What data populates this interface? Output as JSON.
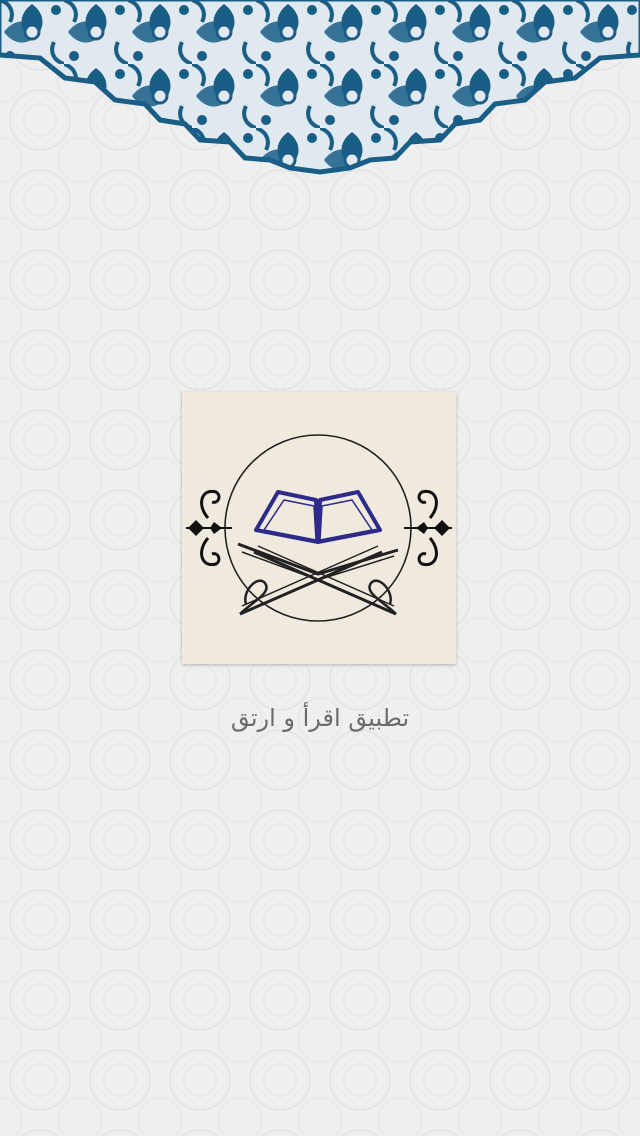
{
  "splash": {
    "app_name": "تطبيق اقرأ و ارتق",
    "logo_icon": "quran-on-stand-icon",
    "ornament": "islamic-arabesque-ornament"
  },
  "colors": {
    "background": "#efefef",
    "pattern_line": "#e2e2e2",
    "ornament_dark": "#1a5e86",
    "ornament_light": "#dfe9ef",
    "logo_background": "#f0e9dd",
    "book_outline": "#2e2a8a",
    "app_name_text": "#6b6b6b"
  }
}
